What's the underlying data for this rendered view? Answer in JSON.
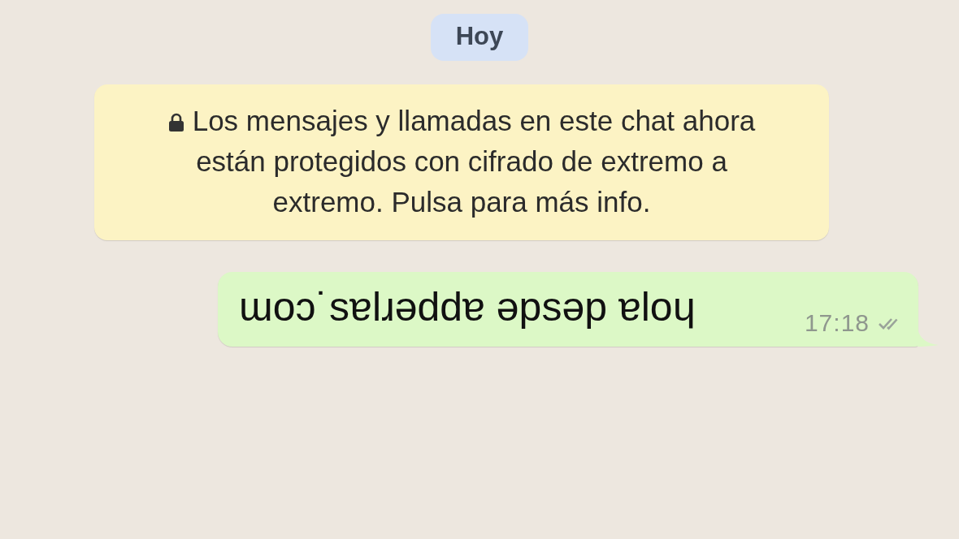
{
  "date_chip": {
    "label": "Hoy"
  },
  "notice": {
    "locked": true,
    "text": "Los mensajes y llamadas en este chat ahora están protegidos con cifrado de extremo a extremo. Pulsa para más info."
  },
  "messages": [
    {
      "kind": "outgoing",
      "text": "ɯoɔ˙sɐlɹǝddɐ ǝpsǝp ɐloɥ",
      "time": "17:18",
      "read": false
    }
  ]
}
